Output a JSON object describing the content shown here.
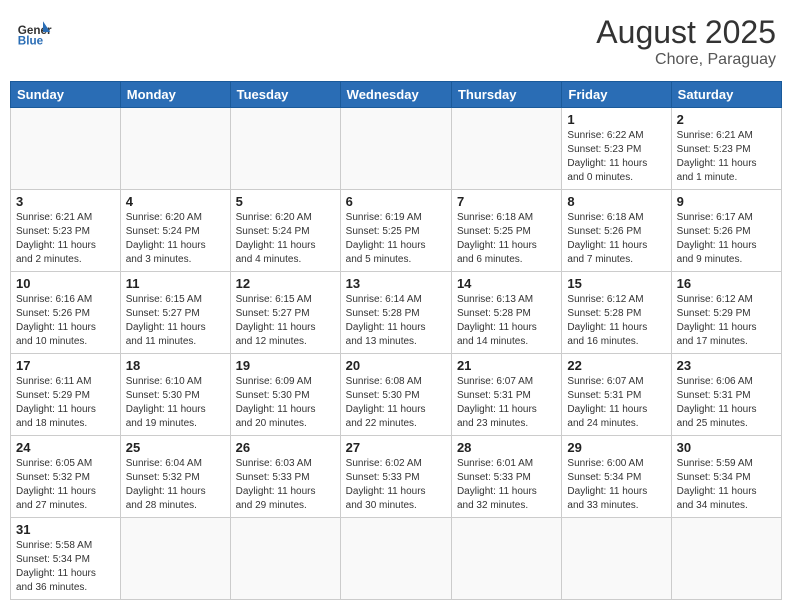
{
  "header": {
    "logo_general": "General",
    "logo_blue": "Blue",
    "month_year": "August 2025",
    "location": "Chore, Paraguay"
  },
  "weekdays": [
    "Sunday",
    "Monday",
    "Tuesday",
    "Wednesday",
    "Thursday",
    "Friday",
    "Saturday"
  ],
  "weeks": [
    [
      {
        "day": "",
        "info": ""
      },
      {
        "day": "",
        "info": ""
      },
      {
        "day": "",
        "info": ""
      },
      {
        "day": "",
        "info": ""
      },
      {
        "day": "",
        "info": ""
      },
      {
        "day": "1",
        "info": "Sunrise: 6:22 AM\nSunset: 5:23 PM\nDaylight: 11 hours\nand 0 minutes."
      },
      {
        "day": "2",
        "info": "Sunrise: 6:21 AM\nSunset: 5:23 PM\nDaylight: 11 hours\nand 1 minute."
      }
    ],
    [
      {
        "day": "3",
        "info": "Sunrise: 6:21 AM\nSunset: 5:23 PM\nDaylight: 11 hours\nand 2 minutes."
      },
      {
        "day": "4",
        "info": "Sunrise: 6:20 AM\nSunset: 5:24 PM\nDaylight: 11 hours\nand 3 minutes."
      },
      {
        "day": "5",
        "info": "Sunrise: 6:20 AM\nSunset: 5:24 PM\nDaylight: 11 hours\nand 4 minutes."
      },
      {
        "day": "6",
        "info": "Sunrise: 6:19 AM\nSunset: 5:25 PM\nDaylight: 11 hours\nand 5 minutes."
      },
      {
        "day": "7",
        "info": "Sunrise: 6:18 AM\nSunset: 5:25 PM\nDaylight: 11 hours\nand 6 minutes."
      },
      {
        "day": "8",
        "info": "Sunrise: 6:18 AM\nSunset: 5:26 PM\nDaylight: 11 hours\nand 7 minutes."
      },
      {
        "day": "9",
        "info": "Sunrise: 6:17 AM\nSunset: 5:26 PM\nDaylight: 11 hours\nand 9 minutes."
      }
    ],
    [
      {
        "day": "10",
        "info": "Sunrise: 6:16 AM\nSunset: 5:26 PM\nDaylight: 11 hours\nand 10 minutes."
      },
      {
        "day": "11",
        "info": "Sunrise: 6:15 AM\nSunset: 5:27 PM\nDaylight: 11 hours\nand 11 minutes."
      },
      {
        "day": "12",
        "info": "Sunrise: 6:15 AM\nSunset: 5:27 PM\nDaylight: 11 hours\nand 12 minutes."
      },
      {
        "day": "13",
        "info": "Sunrise: 6:14 AM\nSunset: 5:28 PM\nDaylight: 11 hours\nand 13 minutes."
      },
      {
        "day": "14",
        "info": "Sunrise: 6:13 AM\nSunset: 5:28 PM\nDaylight: 11 hours\nand 14 minutes."
      },
      {
        "day": "15",
        "info": "Sunrise: 6:12 AM\nSunset: 5:28 PM\nDaylight: 11 hours\nand 16 minutes."
      },
      {
        "day": "16",
        "info": "Sunrise: 6:12 AM\nSunset: 5:29 PM\nDaylight: 11 hours\nand 17 minutes."
      }
    ],
    [
      {
        "day": "17",
        "info": "Sunrise: 6:11 AM\nSunset: 5:29 PM\nDaylight: 11 hours\nand 18 minutes."
      },
      {
        "day": "18",
        "info": "Sunrise: 6:10 AM\nSunset: 5:30 PM\nDaylight: 11 hours\nand 19 minutes."
      },
      {
        "day": "19",
        "info": "Sunrise: 6:09 AM\nSunset: 5:30 PM\nDaylight: 11 hours\nand 20 minutes."
      },
      {
        "day": "20",
        "info": "Sunrise: 6:08 AM\nSunset: 5:30 PM\nDaylight: 11 hours\nand 22 minutes."
      },
      {
        "day": "21",
        "info": "Sunrise: 6:07 AM\nSunset: 5:31 PM\nDaylight: 11 hours\nand 23 minutes."
      },
      {
        "day": "22",
        "info": "Sunrise: 6:07 AM\nSunset: 5:31 PM\nDaylight: 11 hours\nand 24 minutes."
      },
      {
        "day": "23",
        "info": "Sunrise: 6:06 AM\nSunset: 5:31 PM\nDaylight: 11 hours\nand 25 minutes."
      }
    ],
    [
      {
        "day": "24",
        "info": "Sunrise: 6:05 AM\nSunset: 5:32 PM\nDaylight: 11 hours\nand 27 minutes."
      },
      {
        "day": "25",
        "info": "Sunrise: 6:04 AM\nSunset: 5:32 PM\nDaylight: 11 hours\nand 28 minutes."
      },
      {
        "day": "26",
        "info": "Sunrise: 6:03 AM\nSunset: 5:33 PM\nDaylight: 11 hours\nand 29 minutes."
      },
      {
        "day": "27",
        "info": "Sunrise: 6:02 AM\nSunset: 5:33 PM\nDaylight: 11 hours\nand 30 minutes."
      },
      {
        "day": "28",
        "info": "Sunrise: 6:01 AM\nSunset: 5:33 PM\nDaylight: 11 hours\nand 32 minutes."
      },
      {
        "day": "29",
        "info": "Sunrise: 6:00 AM\nSunset: 5:34 PM\nDaylight: 11 hours\nand 33 minutes."
      },
      {
        "day": "30",
        "info": "Sunrise: 5:59 AM\nSunset: 5:34 PM\nDaylight: 11 hours\nand 34 minutes."
      }
    ],
    [
      {
        "day": "31",
        "info": "Sunrise: 5:58 AM\nSunset: 5:34 PM\nDaylight: 11 hours\nand 36 minutes."
      },
      {
        "day": "",
        "info": ""
      },
      {
        "day": "",
        "info": ""
      },
      {
        "day": "",
        "info": ""
      },
      {
        "day": "",
        "info": ""
      },
      {
        "day": "",
        "info": ""
      },
      {
        "day": "",
        "info": ""
      }
    ]
  ]
}
